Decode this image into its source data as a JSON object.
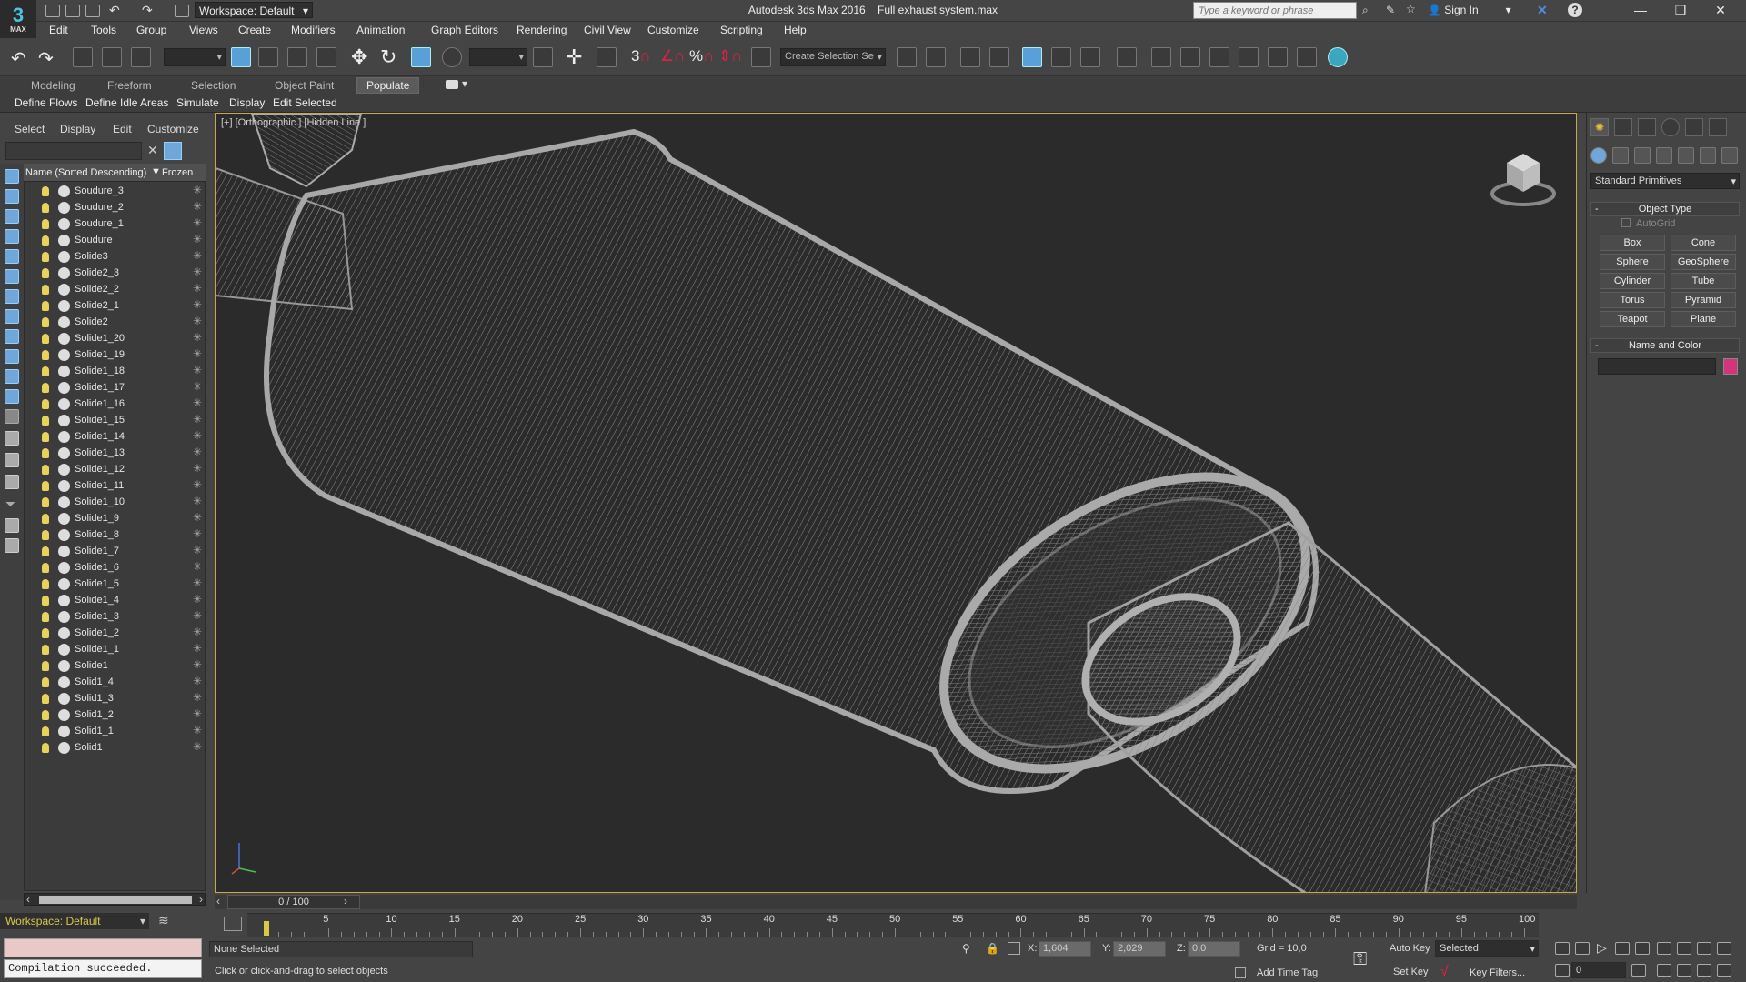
{
  "titlebar": {
    "logo_text": "MAX",
    "workspace": "Workspace: Default",
    "app_title": "Autodesk 3ds Max 2016",
    "file_name": "Full exhaust system.max",
    "search_placeholder": "Type a keyword or phrase",
    "sign_in": "Sign In",
    "help": "?",
    "minimize": "—",
    "maximize": "❒",
    "close": "✕"
  },
  "menus": [
    "Edit",
    "Tools",
    "Group",
    "Views",
    "Create",
    "Modifiers",
    "Animation",
    "Graph Editors",
    "Rendering",
    "Civil View",
    "Customize",
    "Scripting",
    "Help"
  ],
  "toolbar": {
    "named_selection_placeholder": "Create Selection Se",
    "icons": [
      "undo-icon",
      "redo-icon",
      "link-icon",
      "unlink-icon",
      "bind-space-warp-icon",
      "select-object-icon",
      "select-by-name-icon",
      "rect-select-icon",
      "window-crossing-icon",
      "move-icon",
      "rotate-icon",
      "scale-icon",
      "select-manipulate-icon",
      "pivot-icon",
      "snap-icon",
      "angle-snap-icon",
      "percent-snap-icon",
      "spinner-snap-icon",
      "edit-named-selection-icon",
      "mirror-icon",
      "align-icon",
      "layer-icon",
      "scene-explorer-icon",
      "curve-editor-icon",
      "schematic-icon",
      "material-editor-icon",
      "render-setup-icon",
      "render-frame-icon",
      "render-icon",
      "a360-icon"
    ]
  },
  "ribbon": {
    "tabs": [
      "Modeling",
      "Freeform",
      "Selection",
      "Object Paint",
      "Populate"
    ],
    "active_tab": "Populate",
    "sub_items": [
      "Define Flows",
      "Define Idle Areas",
      "Simulate",
      "Display",
      "Edit Selected"
    ]
  },
  "scene_explorer": {
    "menu": [
      "Select",
      "Display",
      "Edit",
      "Customize"
    ],
    "col_name": "Name (Sorted Descending)",
    "col_frozen": "Frozen",
    "objects": [
      "Soudure_3",
      "Soudure_2",
      "Soudure_1",
      "Soudure",
      "Solide3",
      "Solide2_3",
      "Solide2_2",
      "Solide2_1",
      "Solide2",
      "Solide1_20",
      "Solide1_19",
      "Solide1_18",
      "Solide1_17",
      "Solide1_16",
      "Solide1_15",
      "Solide1_14",
      "Solide1_13",
      "Solide1_12",
      "Solide1_11",
      "Solide1_10",
      "Solide1_9",
      "Solide1_8",
      "Solide1_7",
      "Solide1_6",
      "Solide1_5",
      "Solide1_4",
      "Solide1_3",
      "Solide1_2",
      "Solide1_1",
      "Solide1",
      "Solid1_4",
      "Solid1_3",
      "Solid1_2",
      "Solid1_1",
      "Solid1"
    ],
    "frozen_glyph": "✳",
    "workspace": "Workspace: Default"
  },
  "maxscript": {
    "output": "Compilation succeeded."
  },
  "viewport": {
    "label": "[+] [Orthographic ] [Hidden Line ]",
    "border_color": "#caa84a"
  },
  "command_panel": {
    "category": "Standard Primitives",
    "object_type_title": "Object Type",
    "autogrid": "AutoGrid",
    "primitives": [
      "Box",
      "Cone",
      "Sphere",
      "GeoSphere",
      "Cylinder",
      "Tube",
      "Torus",
      "Pyramid",
      "Teapot",
      "Plane"
    ],
    "name_color_title": "Name and Color",
    "object_color": "#d2357c"
  },
  "timeline": {
    "frame_display": "0 / 100",
    "ticks": [
      "5",
      "10",
      "15",
      "20",
      "25",
      "30",
      "35",
      "40",
      "45",
      "50",
      "55",
      "60",
      "65",
      "70",
      "75",
      "80",
      "85",
      "90",
      "95",
      "100"
    ]
  },
  "statusbar": {
    "selection": "None Selected",
    "prompt": "Click or click-and-drag to select objects",
    "x_label": "X:",
    "x_value": "1,604",
    "y_label": "Y:",
    "y_value": "2,029",
    "z_label": "Z:",
    "z_value": "0,0",
    "grid": "Grid = 10,0",
    "add_time_tag": "Add Time Tag",
    "auto_key": "Auto Key",
    "set_key": "Set Key",
    "key_mode": "Selected",
    "key_filters": "Key Filters...",
    "current_frame": "0"
  }
}
